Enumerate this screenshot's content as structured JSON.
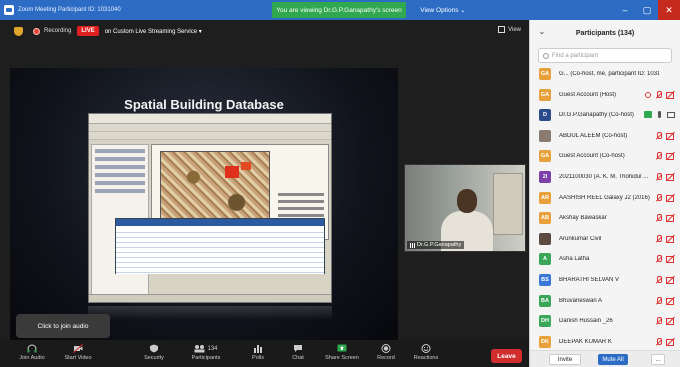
{
  "window": {
    "title": "Zoom Meeting Participant ID: 1031040",
    "viewing_banner": "You are viewing Dr.G.P.Ganapathy's screen",
    "view_options": "View Options ⌄",
    "controls": [
      "–",
      "▢",
      "✕"
    ]
  },
  "topbar": {
    "recording": "Recording",
    "live": "LIVE",
    "livestream": "on Custom Live Streaming Service ▾",
    "view": "View"
  },
  "share": {
    "slide_title": "Spatial Building Database"
  },
  "speaker": {
    "name": "Dr.G.P.Ganapathy"
  },
  "toolbar": {
    "tooltip": "Click to join audio",
    "participants_count": "134",
    "buttons": [
      {
        "label": "Join Audio",
        "icon": "headphones-icon"
      },
      {
        "label": "Start Video",
        "icon": "camera-off-icon"
      },
      {
        "label": "Security",
        "icon": "shield-icon"
      },
      {
        "label": "Participants",
        "icon": "people-icon"
      },
      {
        "label": "Polls",
        "icon": "bar-chart-icon"
      },
      {
        "label": "Chat",
        "icon": "chat-icon"
      },
      {
        "label": "Share Screen",
        "icon": "share-screen-icon"
      },
      {
        "label": "Record",
        "icon": "record-icon"
      },
      {
        "label": "Reactions",
        "icon": "emoji-icon"
      }
    ],
    "leave": "Leave"
  },
  "panel": {
    "title": "Participants (134)",
    "search_placeholder": "Find a participant",
    "participants": [
      {
        "initials": "GA",
        "color": "#e8a13a",
        "name": "G... (Co-host, me, participant ID: 1031040)",
        "icons": []
      },
      {
        "initials": "GA",
        "color": "#e8a13a",
        "name": "Guest Account (Host)",
        "icons": [
          "record",
          "mic-off",
          "cam-off"
        ]
      },
      {
        "initials": "D",
        "color": "#2b4b8a",
        "name": "Dr.G.P.Ganapathy (Co-host)",
        "icons": [
          "share",
          "mic",
          "cam"
        ]
      },
      {
        "initials": "",
        "color": "#8a7a70",
        "name": "ABDUL ALEEM (Co-host)",
        "icons": [
          "mic-off",
          "cam-off"
        ]
      },
      {
        "initials": "GA",
        "color": "#e8a13a",
        "name": "Guest Account (Co-host)",
        "icons": [
          "mic-off",
          "cam-off"
        ]
      },
      {
        "initials": "2I",
        "color": "#7d3fa8",
        "name": "2021100030 (A. K. M. Thohidul ...",
        "icons": [
          "mic-off",
          "cam-off"
        ]
      },
      {
        "initials": "AR",
        "color": "#e8a13a",
        "name": "AASHISH REEL Galaxy J2 (2016)",
        "icons": [
          "mic-off",
          "cam-off"
        ]
      },
      {
        "initials": "AB",
        "color": "#e8a13a",
        "name": "Akshay Bawaskar",
        "icons": [
          "mic-off",
          "cam-off"
        ]
      },
      {
        "initials": "",
        "color": "#5a4a40",
        "name": "Arunkumar Civil",
        "icons": [
          "mic-off",
          "cam-off"
        ]
      },
      {
        "initials": "A",
        "color": "#3aa65a",
        "name": "Asha Latha",
        "icons": [
          "mic-off",
          "cam-off"
        ]
      },
      {
        "initials": "BS",
        "color": "#3a7ad6",
        "name": "BHARATHI SELVAN V",
        "icons": [
          "mic-off",
          "cam-off"
        ]
      },
      {
        "initials": "BA",
        "color": "#3aa65a",
        "name": "Bhuvaneswari A",
        "icons": [
          "mic-off",
          "cam-off"
        ]
      },
      {
        "initials": "DH",
        "color": "#3aa65a",
        "name": "Danish Hussain _26",
        "icons": [
          "mic-off",
          "cam-off"
        ]
      },
      {
        "initials": "DK",
        "color": "#e8a13a",
        "name": "DEEPAK KUMAR K",
        "icons": [
          "mic-off",
          "cam-off"
        ]
      }
    ],
    "footer": {
      "invite": "Invite",
      "mute_all": "Mute All",
      "more": "..."
    }
  }
}
